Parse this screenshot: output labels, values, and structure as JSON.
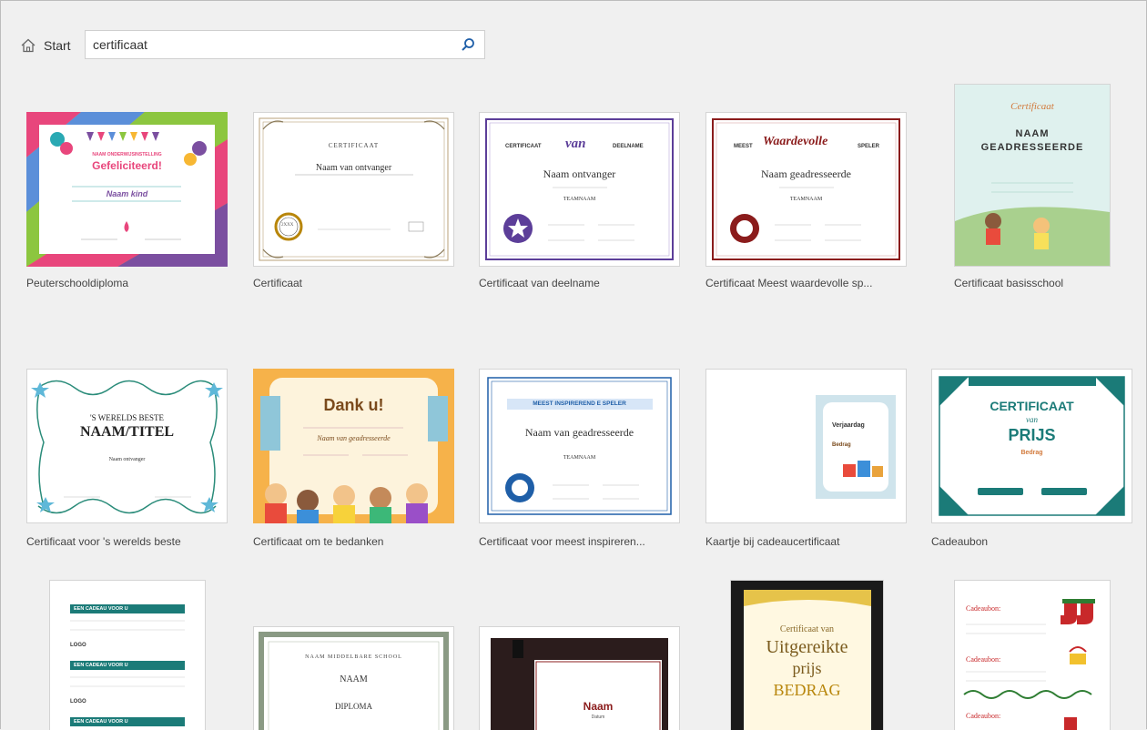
{
  "nav": {
    "home_label": "Start"
  },
  "search": {
    "value": "certificaat"
  },
  "templates": [
    {
      "caption": "Peuterschooldiploma",
      "thumb": {
        "heading": "Gefeliciteerd!",
        "sub": "NAAM ONDERWIJSINSTELLING",
        "name": "Naam kind"
      }
    },
    {
      "caption": "Certificaat",
      "thumb": {
        "heading": "CERTIFICAAT",
        "name": "Naam van ontvanger",
        "seal": "2XXX"
      }
    },
    {
      "caption": "Certificaat van deelname",
      "thumb": {
        "left": "CERTIFICAAT",
        "script": "van",
        "right": "DEELNAME",
        "name": "Naam ontvanger",
        "team": "TEAMNAAM"
      }
    },
    {
      "caption": "Certificaat Meest waardevolle sp...",
      "thumb": {
        "left": "MEEST",
        "script": "Waardevolle",
        "right": "SPELER",
        "name": "Naam geadresseerde",
        "team": "TEAMNAAM"
      }
    },
    {
      "caption": "Certificaat basisschool",
      "thumb": {
        "script": "Certificaat",
        "name1": "NAAM",
        "name2": "GEADRESSEERDE"
      }
    },
    {
      "caption": "Certificaat voor 's werelds beste",
      "thumb": {
        "line1": "'S WERELDS BESTE",
        "line2": "NAAM/TITEL",
        "name": "Naam ontvanger"
      }
    },
    {
      "caption": "Certificaat om te bedanken",
      "thumb": {
        "heading": "Dank u!",
        "name": "Naam van geadresseerde"
      }
    },
    {
      "caption": "Certificaat voor meest inspireren...",
      "thumb": {
        "banner": "MEEST INSPIREREND E SPELER",
        "name": "Naam van geadresseerde",
        "team": "TEAMNAAM"
      }
    },
    {
      "caption": "Kaartje bij cadeaucertificaat",
      "thumb": {
        "line1": "Verjaardag",
        "line2": "Bedrag"
      }
    },
    {
      "caption": "Cadeaubon",
      "thumb": {
        "heading": "CERTIFICAAT",
        "script": "van",
        "name": "PRIJS",
        "sub": "Bedrag"
      }
    },
    {
      "caption": "",
      "thumb": {
        "banner": "EEN CADEAU VOOR U",
        "logo": "LOGO"
      }
    },
    {
      "caption": "",
      "thumb": {
        "school": "NAAM MIDDELBARE SCHOOL",
        "name": "NAAM",
        "title": "DIPLOMA"
      }
    },
    {
      "caption": "",
      "thumb": {
        "name": "Naam",
        "sub": "Datum"
      }
    },
    {
      "caption": "",
      "thumb": {
        "line1": "Certificaat van",
        "line2": "Uitgereikte",
        "line3": "prijs",
        "line4": "BEDRAG"
      }
    },
    {
      "caption": "",
      "thumb": {
        "label": "Cadeaubon:"
      }
    }
  ],
  "colors": {
    "background": "#f0f0f0",
    "accent_blue": "#1f5fa8",
    "teal": "#1b7b78",
    "purple": "#5c3e99",
    "maroon": "#8b1c1c",
    "gold": "#b8860b"
  }
}
